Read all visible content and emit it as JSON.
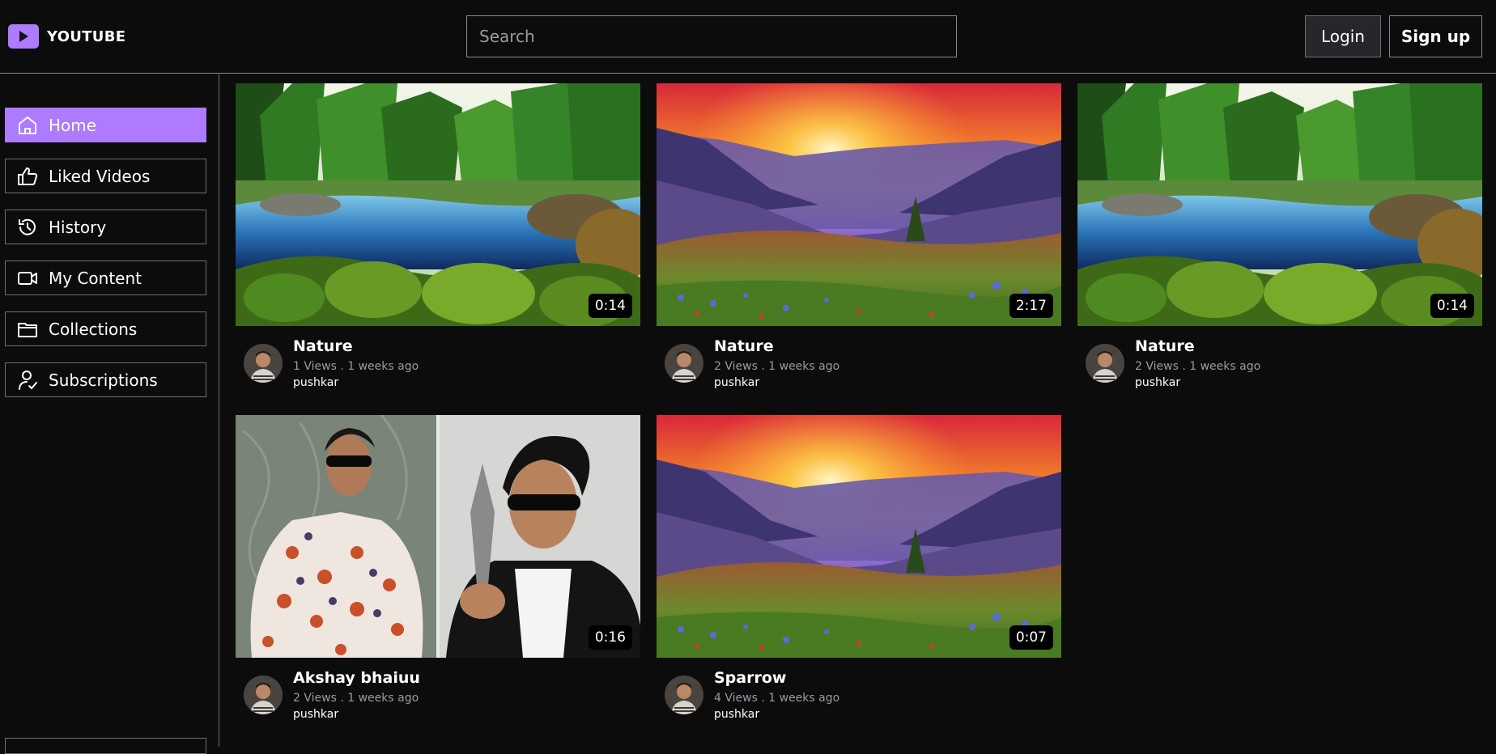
{
  "header": {
    "logo_text": "YOUTUBE",
    "search_placeholder": "Search",
    "login_label": "Login",
    "signup_label": "Sign up",
    "accent": "#ae7aff"
  },
  "sidebar": {
    "items": [
      {
        "label": "Home",
        "icon": "home-icon",
        "active": true
      },
      {
        "label": "Liked Videos",
        "icon": "thumbs-up-icon",
        "active": false
      },
      {
        "label": "History",
        "icon": "history-icon",
        "active": false
      },
      {
        "label": "My Content",
        "icon": "video-camera-icon",
        "active": false
      },
      {
        "label": "Collections",
        "icon": "folder-icon",
        "active": false
      },
      {
        "label": "Subscriptions",
        "icon": "user-check-icon",
        "active": false
      }
    ]
  },
  "videos": [
    {
      "title": "Nature",
      "stats": "1 Views . 1 weeks ago",
      "channel": "pushkar",
      "duration": "0:14",
      "thumbnail": "forest-river"
    },
    {
      "title": "Nature",
      "stats": "2 Views . 1 weeks ago",
      "channel": "pushkar",
      "duration": "2:17",
      "thumbnail": "mountain-sunset"
    },
    {
      "title": "Nature",
      "stats": "2 Views . 1 weeks ago",
      "channel": "pushkar",
      "duration": "0:14",
      "thumbnail": "forest-river"
    },
    {
      "title": "Akshay bhaiuu",
      "stats": "2 Views . 1 weeks ago",
      "channel": "pushkar",
      "duration": "0:16",
      "thumbnail": "two-men-sunglasses"
    },
    {
      "title": "Sparrow",
      "stats": "4 Views . 1 weeks ago",
      "channel": "pushkar",
      "duration": "0:07",
      "thumbnail": "mountain-sunset"
    }
  ]
}
